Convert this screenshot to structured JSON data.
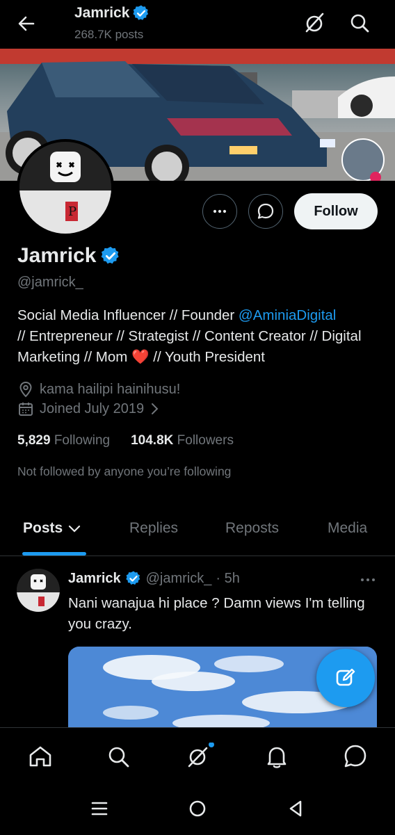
{
  "header": {
    "title": "Jamrick",
    "posts_count": "268.7K posts"
  },
  "profile": {
    "name": "Jamrick",
    "handle": "@jamrick_",
    "follow_label": "Follow",
    "bio_part1": "Social Media Influencer // Founder ",
    "bio_mention": "@AminiaDigital",
    "bio_part2": "//  Entrepreneur // Strategist  // Content Creator // Digital Marketing // Mom ",
    "bio_heart": "❤️",
    "bio_part3": " // Youth President",
    "location": "kama hailipi hainihusu!",
    "joined": "Joined July 2019",
    "following_count": "5,829",
    "following_label": "Following",
    "followers_count": "104.8K",
    "followers_label": "Followers",
    "not_followed": "Not followed by anyone you’re following"
  },
  "tabs": [
    "Posts",
    "Replies",
    "Reposts",
    "Media"
  ],
  "post": {
    "name": "Jamrick",
    "handle": "@jamrick_",
    "time": "· 5h",
    "text": "Nani wanajua hi place ? Damn views I'm telling you crazy."
  },
  "colors": {
    "accent": "#1d9bf0",
    "muted": "#71767b",
    "text": "#e7e9ea",
    "background": "#000000"
  },
  "icons": {
    "back": "arrow-left-icon",
    "grok": "grok-icon",
    "search": "search-icon",
    "verified": "verified-badge-icon",
    "location": "location-pin-icon",
    "calendar": "calendar-icon",
    "compose": "compose-icon",
    "nav": [
      "home-icon",
      "search-icon",
      "grok-icon",
      "notifications-icon",
      "messages-icon"
    ]
  }
}
